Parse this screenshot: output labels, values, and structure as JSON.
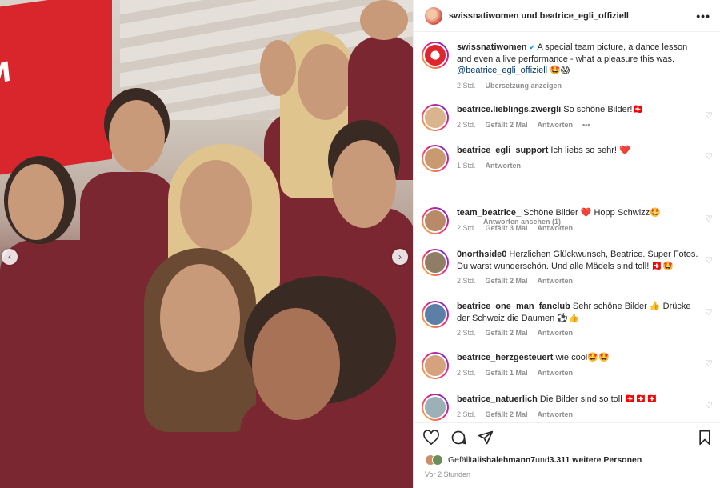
{
  "photo": {
    "banner_text": "M",
    "prev_arrow": "‹",
    "next_arrow": "›"
  },
  "header": {
    "title": "swissnatiwomen und beatrice_egli_offiziell",
    "more": "•••"
  },
  "caption": {
    "user": "swissnatiwomen",
    "verified": "✔",
    "text": " A special team picture, a dance lesson and even a live performance - what a pleasure this was.",
    "mention": "@beatrice_egli_offiziell",
    "emoji": " 🤩😱",
    "time": "2 Std.",
    "translate": "Übersetzung anzeigen"
  },
  "comments": [
    {
      "user": "beatrice.lieblings.zwergli",
      "text": " So schöne Bilder!🇨🇭",
      "time": "2 Std.",
      "likes": "Gefällt 2 Mal",
      "reply": "Antworten",
      "extra": "•••"
    },
    {
      "user": "beatrice_egli_support",
      "text": " Ich liebs so sehr! ❤️",
      "time": "1 Std.",
      "likes": "",
      "reply": "Antworten",
      "extra": ""
    },
    {
      "user": "team_beatrice_",
      "text": " Schöne Bilder ❤️ Hopp Schwizz🤩",
      "time": "2 Std.",
      "likes": "Gefällt 3 Mal",
      "reply": "Antworten",
      "extra": ""
    },
    {
      "user": "0northside0",
      "text": " Herzlichen Glückwunsch, Beatrice. Super Fotos. Du warst wunderschön. Und alle Mädels sind toll! 🇨🇭🤩",
      "time": "2 Std.",
      "likes": "Gefällt 2 Mal",
      "reply": "Antworten",
      "extra": ""
    },
    {
      "user": "beatrice_one_man_fanclub",
      "text": " Sehr schöne Bilder 👍 Drücke der Schweiz die Daumen ⚽👍",
      "time": "2 Std.",
      "likes": "Gefällt 2 Mal",
      "reply": "Antworten",
      "extra": ""
    },
    {
      "user": "beatrice_herzgesteuert",
      "text": " wie cool🤩🤩",
      "time": "2 Std.",
      "likes": "Gefällt 1 Mal",
      "reply": "Antworten",
      "extra": ""
    },
    {
      "user": "beatrice_natuerlich",
      "text": " Die Bilder sind so toll 🇨🇭🇨🇭🇨🇭",
      "time": "2 Std.",
      "likes": "Gefällt 2 Mal",
      "reply": "Antworten",
      "extra": ""
    }
  ],
  "view_replies": "Antworten ansehen (1)",
  "likes": {
    "prefix": "Gefällt ",
    "user": "alishalehmann7",
    "mid": " und ",
    "count": "3.311 weitere Personen"
  },
  "time_ago": "Vor 2 Stunden",
  "heart": "♡",
  "colors": {
    "accent": "#0095f6",
    "mention": "#00376b",
    "muted": "#8e8e8e",
    "jersey": "#7a2731",
    "banner": "#d8262c"
  }
}
